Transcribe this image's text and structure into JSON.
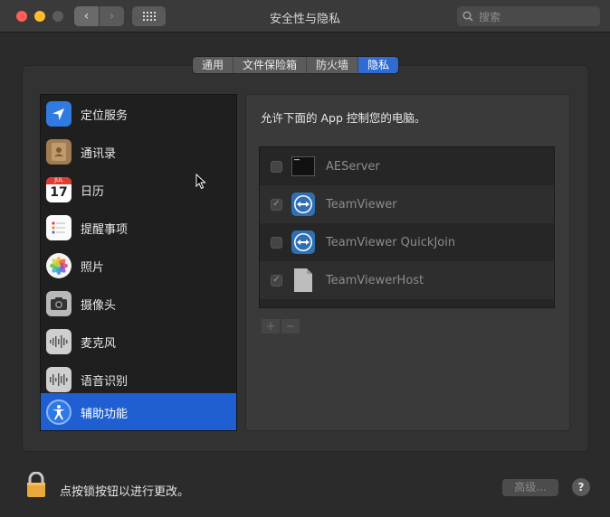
{
  "window": {
    "title": "安全性与隐私",
    "search_placeholder": "搜索"
  },
  "tabs": [
    {
      "label": "通用",
      "active": false
    },
    {
      "label": "文件保险箱",
      "active": false
    },
    {
      "label": "防火墙",
      "active": false
    },
    {
      "label": "隐私",
      "active": true
    }
  ],
  "sidebar": {
    "items": [
      {
        "label": "定位服务",
        "icon": "location-arrow-icon",
        "selected": false
      },
      {
        "label": "通讯录",
        "icon": "contacts-book-icon",
        "selected": false
      },
      {
        "label": "日历",
        "icon": "calendar-icon",
        "selected": false,
        "calendar_month": "JUL",
        "calendar_day": "17"
      },
      {
        "label": "提醒事项",
        "icon": "reminders-icon",
        "selected": false
      },
      {
        "label": "照片",
        "icon": "photos-icon",
        "selected": false
      },
      {
        "label": "摄像头",
        "icon": "camera-icon",
        "selected": false
      },
      {
        "label": "麦克风",
        "icon": "microphone-waveform-icon",
        "selected": false
      },
      {
        "label": "语音识别",
        "icon": "speech-waveform-icon",
        "selected": false
      },
      {
        "label": "辅助功能",
        "icon": "accessibility-icon",
        "selected": true
      }
    ]
  },
  "main": {
    "prompt": "允许下面的 App 控制您的电脑。",
    "apps": [
      {
        "name": "AEServer",
        "checked": false,
        "icon": "terminal-app-icon"
      },
      {
        "name": "TeamViewer",
        "checked": true,
        "icon": "teamviewer-icon"
      },
      {
        "name": "TeamViewer QuickJoin",
        "checked": false,
        "icon": "teamviewer-icon"
      },
      {
        "name": "TeamViewerHost",
        "checked": true,
        "icon": "generic-document-icon"
      }
    ],
    "add_label": "+",
    "remove_label": "−"
  },
  "footer": {
    "lock_text": "点按锁按钮以进行更改。",
    "advanced_label": "高级...",
    "help_label": "?"
  },
  "colors": {
    "accent": "#1f5fd1",
    "tab_active": "#2f6bd1"
  }
}
